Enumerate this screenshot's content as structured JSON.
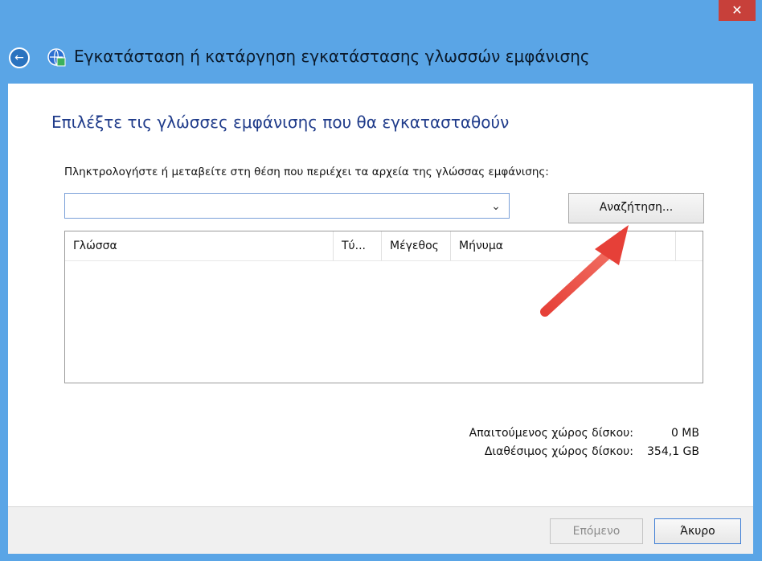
{
  "window": {
    "title": "Εγκατάσταση ή κατάργηση εγκατάστασης γλωσσών εμφάνισης",
    "close_label": "✕"
  },
  "content": {
    "heading": "Επιλέξτε τις γλώσσες εμφάνισης που θα εγκατασταθούν",
    "prompt": "Πληκτρολογήστε ή μεταβείτε στη θέση που περιέχει τα αρχεία της γλώσσας εμφάνισης:",
    "path_input": {
      "value": "",
      "placeholder": ""
    },
    "browse_label": "Αναζήτηση...",
    "table": {
      "columns": [
        "Γλώσσα",
        "Τύ...",
        "Μέγεθος",
        "Μήνυμα",
        ""
      ],
      "rows": []
    },
    "disk": {
      "required_label": "Απαιτούμενος χώρος δίσκου:",
      "required_value": "0 MB",
      "available_label": "Διαθέσιμος χώρος δίσκου:",
      "available_value": "354,1 GB"
    }
  },
  "footer": {
    "next_label": "Επόμενο",
    "cancel_label": "Άκυρο"
  },
  "annotation": {
    "arrow_color": "#e64038"
  },
  "icons": {
    "back": "back-arrow-icon",
    "app": "language-globe-icon",
    "dropdown": "chevron-down-icon",
    "close": "close-icon"
  }
}
